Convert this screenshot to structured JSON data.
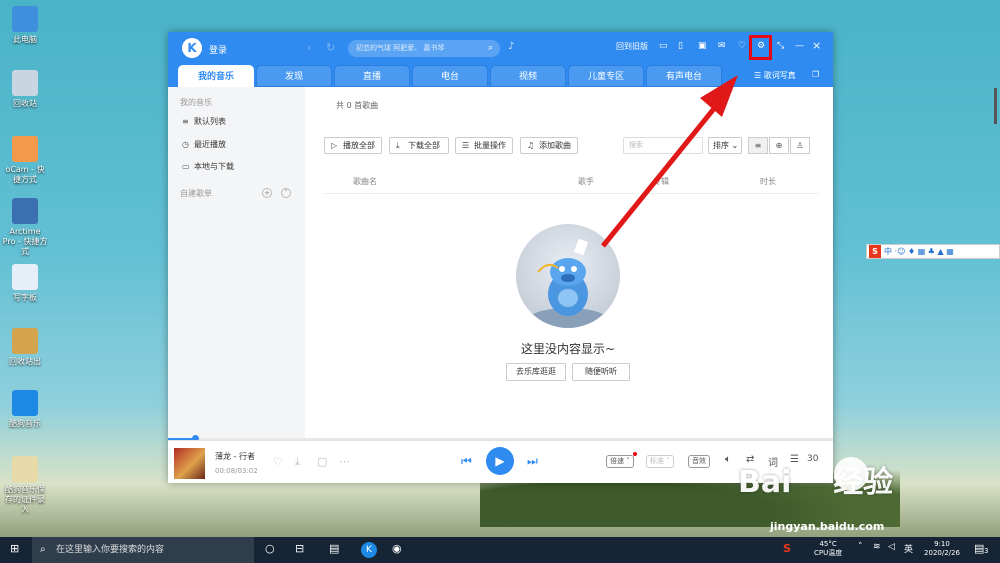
{
  "desktop": {
    "icons": [
      {
        "label": "此电脑",
        "icon": "computer-icon",
        "color": "#3f8fdc"
      },
      {
        "label": "回收站",
        "icon": "recycle-bin-icon",
        "color": "#c9d6e2"
      },
      {
        "label": "oCam - 快捷方式",
        "icon": "ocam-icon",
        "color": "#f2994a"
      },
      {
        "label": "Arctime Pro - 快捷方式",
        "icon": "arctime-icon",
        "color": "#3b6fb0"
      },
      {
        "label": "写字板",
        "icon": "wordpad-icon",
        "color": "#e6eef7"
      },
      {
        "label": "回收站出",
        "icon": "folder-icon",
        "color": "#d3a44b"
      },
      {
        "label": "酷狗音乐",
        "icon": "kugou-icon",
        "color": "#1e88e5"
      },
      {
        "label": "酷狗音乐保存的证件录入",
        "icon": "document-icon",
        "color": "#e8d9a8"
      }
    ],
    "ime_bar": {
      "logo": "S",
      "label": "中"
    },
    "watermark": {
      "text": "Bai",
      "text2": "经验",
      "url": "jingyan.baidu.com"
    }
  },
  "app": {
    "logo_letter": "K",
    "login_label": "登录",
    "search_placeholder": "初恋的气球 阿肥爱、 嘉书琴",
    "top_right_text": "回到旧版",
    "accent_color": "#2f8bf0",
    "tabs": [
      {
        "label": "我的音乐",
        "active": true
      },
      {
        "label": "发现",
        "active": false
      },
      {
        "label": "直播",
        "active": false
      },
      {
        "label": "电台",
        "active": false
      },
      {
        "label": "视频",
        "active": false
      },
      {
        "label": "儿童专区",
        "active": false
      },
      {
        "label": "有声电台",
        "active": false
      }
    ],
    "lyric_label": "歌词写真"
  },
  "sidebar": {
    "section_title": "我的音乐",
    "items": [
      {
        "label": "默认列表",
        "icon": "playlist-icon"
      },
      {
        "label": "最近播放",
        "icon": "clock-icon"
      },
      {
        "label": "本地与下载",
        "icon": "monitor-icon"
      }
    ],
    "custom_title": "自建歌单"
  },
  "main": {
    "song_count": "共 0 首歌曲",
    "toolbar": {
      "play_all": "播放全部",
      "download_all": "下载全部",
      "batch": "批量操作",
      "add_song": "添加歌曲",
      "filter_placeholder": "搜索",
      "sort": "排序"
    },
    "columns": [
      "歌曲名",
      "歌手",
      "专辑",
      "时长"
    ],
    "empty_text": "这里没内容显示~",
    "empty_actions": [
      "去乐库逛逛",
      "随便听听"
    ]
  },
  "player": {
    "song": "薄龙 - 行者",
    "time": "00:08/03:02",
    "progress_percent": 4,
    "speed_label": "倍速",
    "quality_label": "标准",
    "effect_label": "音效",
    "lyric_label": "词",
    "queue_count": "30"
  },
  "taskbar": {
    "search_placeholder": "在这里输入你要搜索的内容",
    "temp": "45°C",
    "cpu_label": "CPU温度",
    "time": "9:10",
    "date": "2020/2/26",
    "notification_count": "3"
  }
}
